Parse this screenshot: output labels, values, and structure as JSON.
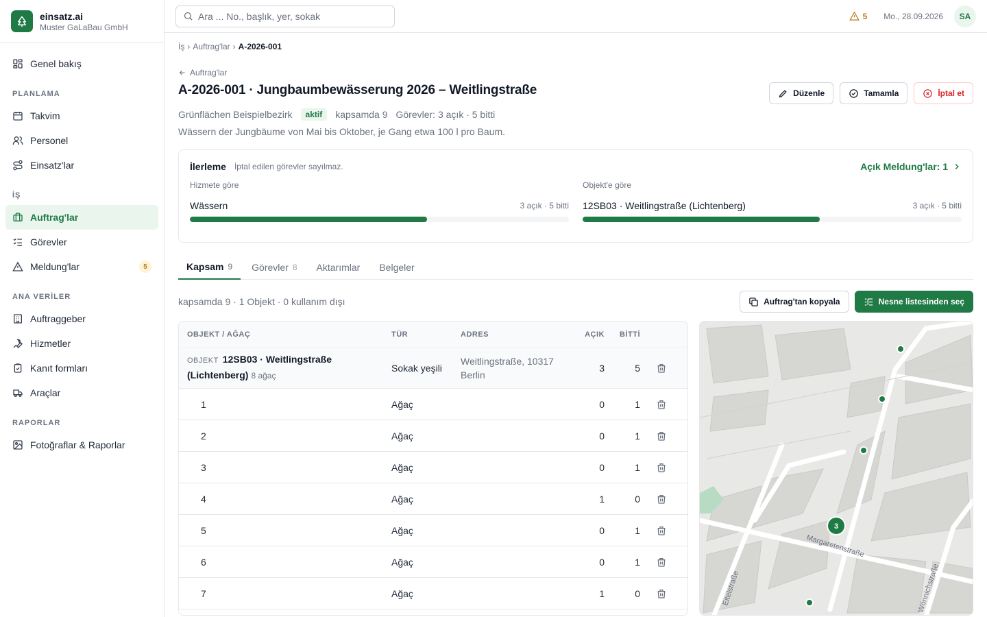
{
  "brand": {
    "name": "einsatz.ai",
    "company": "Muster GaLaBau GmbH"
  },
  "sidebar": {
    "overview": "Genel bakış",
    "sections": {
      "planning": "PLANLAMA",
      "work": "İŞ",
      "master": "ANA VERİLER",
      "reports": "RAPORLAR"
    },
    "planning_items": [
      "Takvim",
      "Personel",
      "Einsatz'lar"
    ],
    "work_items": [
      "Auftrag'lar",
      "Görevler",
      "Meldung'lar"
    ],
    "meldung_badge": "5",
    "master_items": [
      "Auftraggeber",
      "Hizmetler",
      "Kanıt formları",
      "Araçlar"
    ],
    "report_items": [
      "Fotoğraflar & Raporlar"
    ]
  },
  "topbar": {
    "search_placeholder": "Ara ... No., başlık, yer, sokak",
    "warning_count": "5",
    "date": "Mo., 28.09.2026",
    "avatar": "SA"
  },
  "breadcrumb": {
    "root": "İş",
    "parent": "Auftrag'lar",
    "current": "A-2026-001",
    "sep": "›"
  },
  "back_label": "Auftrag'lar",
  "order": {
    "title": "A-2026-001 · Jungbaumbewässerung 2026 – Weitlingstraße",
    "client": "Grünflächen Beispielbezirk",
    "status": "aktif",
    "scope": "kapsamda 9",
    "tasks": "Görevler: 3 açık · 5 bitti",
    "description": "Wässern der Jungbäume von Mai bis Oktober, je Gang etwa 100 l pro Baum.",
    "actions": {
      "edit": "Düzenle",
      "complete": "Tamamla",
      "cancel": "İptal et"
    }
  },
  "progress": {
    "title": "İlerleme",
    "subtitle": "İptal edilen görevler sayılmaz.",
    "link": "Açık Meldung'lar: 1",
    "by_service": {
      "label": "Hizmete göre",
      "name": "Wässern",
      "count": "3 açık · 5 bitti",
      "fraction": 0.625
    },
    "by_object": {
      "label": "Objekt'e göre",
      "name": "12SB03 · Weitlingstraße (Lichtenberg)",
      "count": "3 açık · 5 bitti",
      "fraction": 0.625
    }
  },
  "tabs": [
    {
      "label": "Kapsam",
      "count": "9"
    },
    {
      "label": "Görevler",
      "count": "8"
    },
    {
      "label": "Aktarımlar",
      "count": ""
    },
    {
      "label": "Belgeler",
      "count": ""
    }
  ],
  "scope_toolbar": {
    "summary": "kapsamda 9 · 1 Objekt · 0 kullanım dışı",
    "copy": "Auftrag'tan kopyala",
    "select": "Nesne listesinden seç"
  },
  "table": {
    "headers": {
      "object": "OBJEKT / AĞAÇ",
      "type": "TÜR",
      "address": "ADRES",
      "open": "AÇIK",
      "done": "BİTTİ"
    },
    "object": {
      "tag": "OBJEKT",
      "name": "12SB03 · Weitlingstraße (Lichtenberg)",
      "tree_count": "8 ağaç",
      "type": "Sokak yeşili",
      "address": "Weitlingstraße, 10317 Berlin",
      "open": "3",
      "done": "5"
    },
    "rows": [
      {
        "id": "1",
        "type": "Ağaç",
        "open": "0",
        "done": "1"
      },
      {
        "id": "2",
        "type": "Ağaç",
        "open": "0",
        "done": "1"
      },
      {
        "id": "3",
        "type": "Ağaç",
        "open": "0",
        "done": "1"
      },
      {
        "id": "4",
        "type": "Ağaç",
        "open": "1",
        "done": "0"
      },
      {
        "id": "5",
        "type": "Ağaç",
        "open": "0",
        "done": "1"
      },
      {
        "id": "6",
        "type": "Ağaç",
        "open": "0",
        "done": "1"
      },
      {
        "id": "7",
        "type": "Ağaç",
        "open": "1",
        "done": "0"
      }
    ]
  },
  "map": {
    "cluster_label": "3",
    "streets": [
      "Margaretenstraße",
      "Eitelstraße",
      "Wönnichstraße"
    ]
  },
  "colors": {
    "accent": "#1f7a45",
    "warning": "#b7791f",
    "danger": "#dc2626"
  }
}
